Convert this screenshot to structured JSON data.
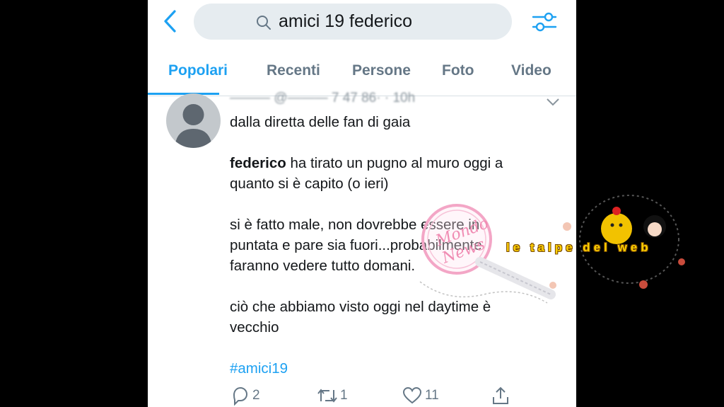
{
  "search": {
    "query": "amici 19 federico"
  },
  "tabs": [
    "Popolari",
    "Recenti",
    "Persone",
    "Foto",
    "Video"
  ],
  "tweet": {
    "header_blurred": "———  @——— 7 47 86· · 10h",
    "lines": {
      "l1": "dalla diretta delle fan di gaia",
      "l2_bold": "federico",
      "l2_rest": " ha tirato un pugno al muro oggi a",
      "l3": "quanto si è capito (o ieri)",
      "l4": "si è fatto male, non dovrebbe essere in",
      "l5": "puntata e pare sia fuori...probabilmente",
      "l6": "faranno vedere tutto domani.",
      "l7": "ciò che abbiamo visto oggi nel daytime è",
      "l8": "vecchio"
    },
    "hashtag": "#amici19",
    "counts": {
      "replies": "2",
      "retweets": "1",
      "likes": "11"
    }
  },
  "watermarks": {
    "stamp": "Mondo News",
    "logo": "le talpe del web"
  },
  "colors": {
    "accent": "#1da1f2",
    "text": "#14171a",
    "muted": "#657786"
  },
  "icons": [
    "back-arrow-icon",
    "search-icon",
    "filter-sliders-icon",
    "chevron-down-icon",
    "reply-icon",
    "retweet-icon",
    "heart-icon",
    "share-icon"
  ]
}
